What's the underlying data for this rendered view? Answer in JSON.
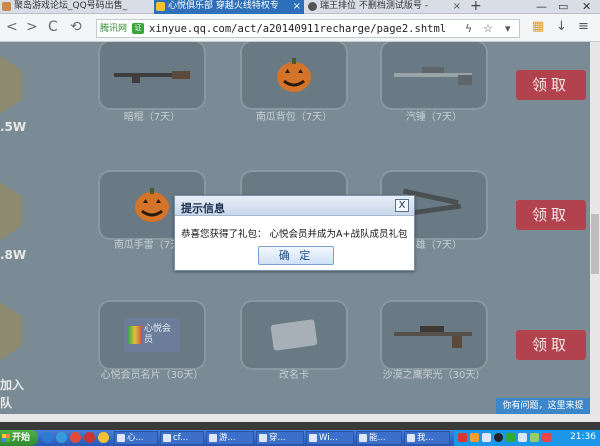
{
  "tabs": [
    {
      "label": "聚岛游戏论坛_QQ号码出售_",
      "active": false
    },
    {
      "label": "心悦俱乐部 穿越火线特权专",
      "active": true
    },
    {
      "label": "瑞王排位 不删档测试版号 -",
      "active": false
    }
  ],
  "new_tab_glyph": "+",
  "window": {
    "minimize": "—",
    "restore": "▭",
    "close": "✕"
  },
  "nav": {
    "back": "<",
    "forward": ">",
    "reload": "C",
    "home": "⟲"
  },
  "address": {
    "security_label": "腾讯网",
    "security_badge": "证",
    "url": "xinyue.qq.com/act/a20140911recharge/page2.shtml"
  },
  "address_icons": {
    "lightning": "ϟ",
    "star": "☆",
    "dropdown": "▾"
  },
  "right_icons": {
    "apps": "▦",
    "download": "↓",
    "menu": "≡"
  },
  "rows": [
    {
      "side_value": ".5W",
      "claim": "领取",
      "items": [
        {
          "icon": "rifle-icon",
          "label": "暗棍（7天）"
        },
        {
          "icon": "pumpkin-bag-icon",
          "label": "南瓜背包（7天）"
        },
        {
          "icon": "sniper-icon",
          "label": "汽锤（7天）"
        }
      ]
    },
    {
      "side_value": ".8W",
      "claim": "领取",
      "items": [
        {
          "icon": "pumpkin-grenade-icon",
          "label": "南瓜手雷（7天）"
        },
        {
          "icon": "pistol-icon",
          "label": ""
        },
        {
          "icon": "dual-gun-icon",
          "label": "双雄（7天）"
        }
      ]
    },
    {
      "side_value": "加入",
      "side_value2": "队",
      "claim": "领取",
      "items": [
        {
          "icon": "vip-card-icon",
          "label": "心悦会员名片（30天）",
          "art_text": "心悦会员"
        },
        {
          "icon": "rename-card-icon",
          "label": "改名卡"
        },
        {
          "icon": "rifle-scope-icon",
          "label": "沙漠之鹰荣光（30天）"
        }
      ]
    }
  ],
  "dialog": {
    "title": "提示信息",
    "close": "X",
    "message": "恭喜您获得了礼包：  心悦会员并成为A+战队成员礼包",
    "ok": "确 定"
  },
  "feedback": "你有问题，这里来提",
  "taskbar": {
    "start": "开始",
    "tasks": [
      "心...",
      "cf...",
      "游...",
      "穿...",
      "Wi...",
      "能...",
      "我..."
    ],
    "clock": "21:36"
  },
  "colors": {
    "accent": "#2d6fb9",
    "claim_button": "#b2424e",
    "taskbar": "#2457b8",
    "overlay": "#7b8b95"
  }
}
